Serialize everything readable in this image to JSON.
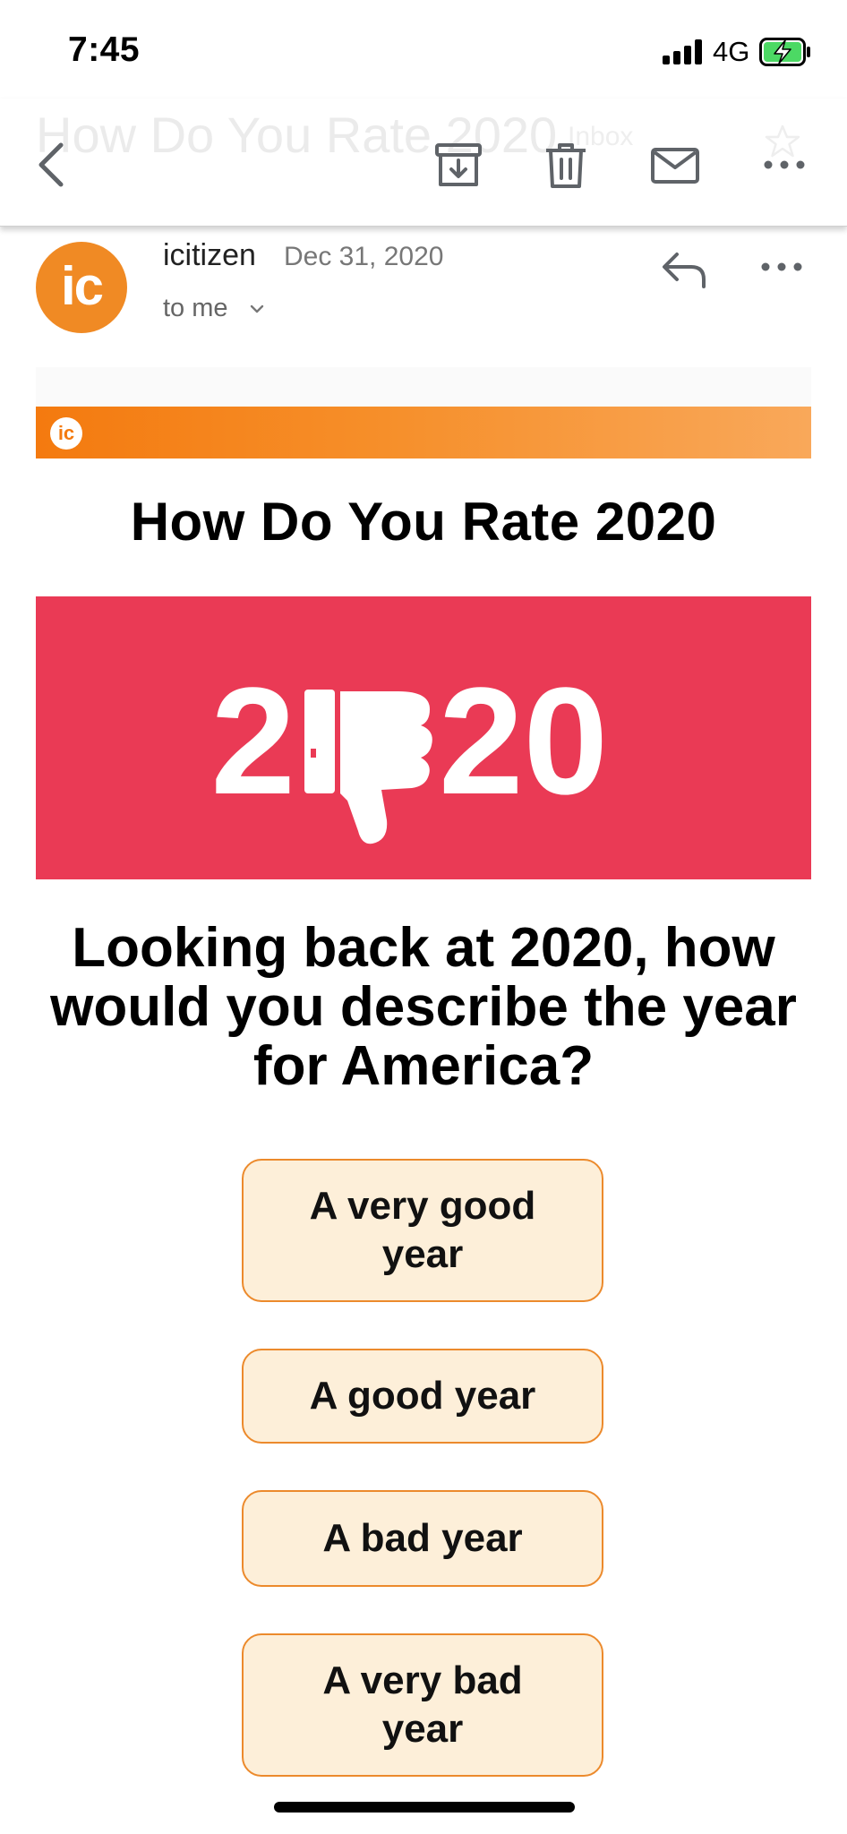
{
  "status_bar": {
    "time": "7:45",
    "network": "4G",
    "battery_state": "charging",
    "battery_color": "#4cd964"
  },
  "toolbar": {
    "subject_behind": "How Do You Rate 2020",
    "label_badge": "Inbox",
    "icons": [
      "back-arrow-icon",
      "archive-icon",
      "trash-icon",
      "mark-unread-icon",
      "more-icon"
    ]
  },
  "sender": {
    "avatar_initials": "ic",
    "avatar_color": "#f08a24",
    "name": "icitizen",
    "date": "Dec 31, 2020",
    "recipient": "to me"
  },
  "email": {
    "brand_logo": "ic",
    "brand_color": "#f47a0f",
    "title": "How Do You Rate 2020",
    "hero": {
      "text_left": "2",
      "text_right": "20",
      "background": "#ea3a55",
      "icon": "thumbs-down-icon"
    },
    "question": "Looking back at 2020, how would you describe the year for America?",
    "options": [
      "A very good year",
      "A good year",
      "A bad year",
      "A very bad year"
    ],
    "option_fill": "#fdefd9",
    "option_border": "#ec8a2c"
  }
}
